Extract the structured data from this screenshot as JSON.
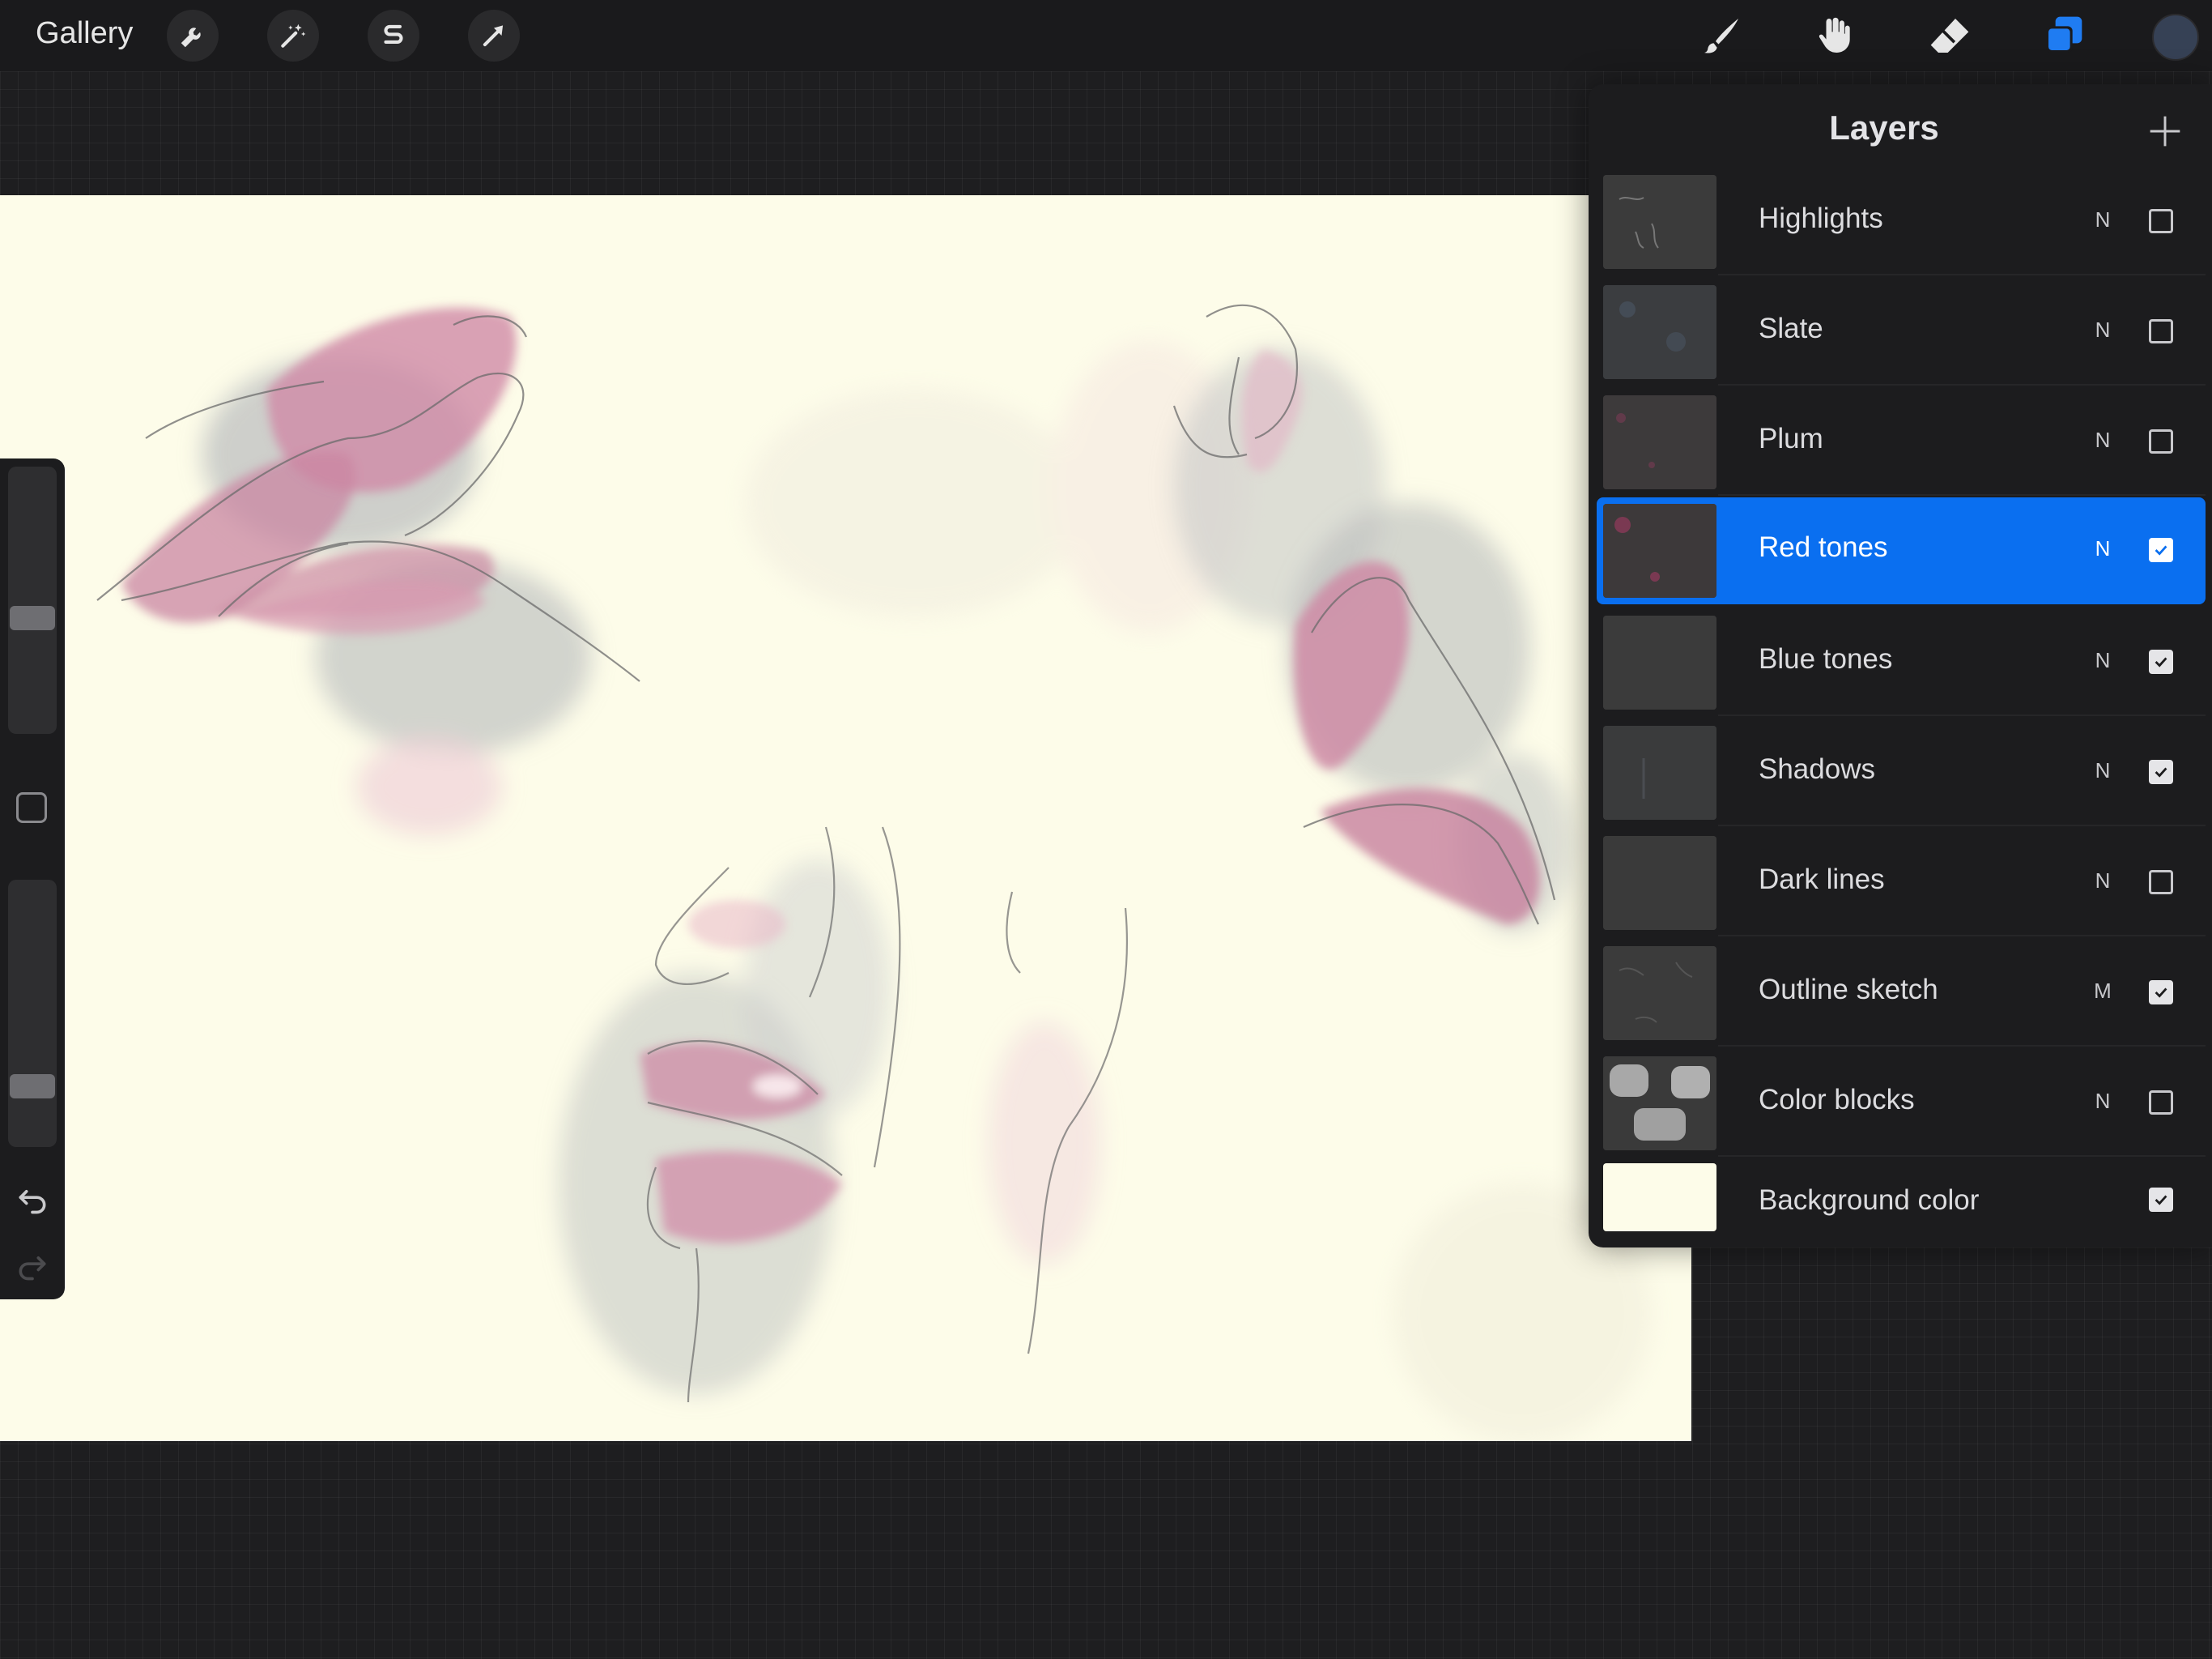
{
  "topbar": {
    "gallery_label": "Gallery",
    "left_tools": [
      "actions-wrench-icon",
      "adjustments-wand-icon",
      "selection-s-icon",
      "transform-arrow-icon"
    ],
    "right_tools": [
      "brush-icon",
      "smudge-icon",
      "eraser-icon",
      "layers-icon"
    ],
    "active_tool": "layers-icon",
    "current_color": "#364155"
  },
  "canvas": {
    "background_color": "#fdfce9",
    "subject": "sketch of lips studies"
  },
  "sidebar": {
    "brush_size_level": 0.55,
    "opacity_level": 0.75,
    "icons": [
      "modify-square-icon",
      "undo-icon",
      "redo-icon"
    ]
  },
  "layers_panel": {
    "title": "Layers",
    "add_icon": "plus-icon",
    "layers": [
      {
        "name": "Highlights",
        "blend": "N",
        "visible": false,
        "active": false
      },
      {
        "name": "Slate",
        "blend": "N",
        "visible": false,
        "active": false
      },
      {
        "name": "Plum",
        "blend": "N",
        "visible": false,
        "active": false
      },
      {
        "name": "Red tones",
        "blend": "N",
        "visible": true,
        "active": true
      },
      {
        "name": "Blue tones",
        "blend": "N",
        "visible": true,
        "active": false
      },
      {
        "name": "Shadows",
        "blend": "N",
        "visible": true,
        "active": false
      },
      {
        "name": "Dark lines",
        "blend": "N",
        "visible": false,
        "active": false
      },
      {
        "name": "Outline sketch",
        "blend": "M",
        "visible": true,
        "active": false
      },
      {
        "name": "Color blocks",
        "blend": "N",
        "visible": false,
        "active": false
      }
    ],
    "background_layer": {
      "name": "Background color",
      "visible": true,
      "color": "#fdfce9"
    },
    "accent_color": "#0a6ff0"
  }
}
